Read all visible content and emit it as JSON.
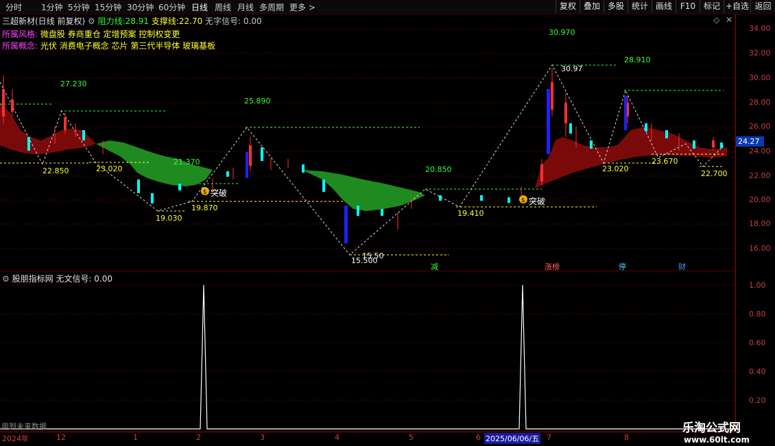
{
  "toolbar": {
    "timeframes": [
      "分时",
      "1分钟",
      "5分钟",
      "15分钟",
      "30分钟",
      "60分钟",
      "日线",
      "周线",
      "月线",
      "多周期",
      "更多 >"
    ],
    "active": "日线",
    "right_buttons": [
      "复权",
      "叠加",
      "多股",
      "统计",
      "画线",
      "F10",
      "标记",
      "+自选",
      "返回"
    ]
  },
  "main_panel": {
    "stock_name": "三超新材(日线 前复权)",
    "resistance_label": "阻力线:",
    "resistance_value": "28.91",
    "support_label": "支撑线:",
    "support_value": "22.70",
    "signal_text": "无字信号: 0.00",
    "style_label": "所属风格:",
    "style_value": "微盘股 券商重仓 定增预案 控制权变更",
    "concept_label": "所属概念:",
    "concept_value": "光伏 消费电子概念 芯片 第三代半导体 玻璃基板",
    "price_ticks": [
      "34.00",
      "32.00",
      "30.00",
      "28.00",
      "26.00",
      "24.00",
      "22.00",
      "20.00",
      "18.00",
      "16.00"
    ],
    "current_price": "24.27",
    "annotations": {
      "a1": "27.230",
      "a2": "22.850",
      "a3": "23.020",
      "a4": "19.030",
      "a5": "19.870",
      "a6": "21.370",
      "a7": "25.890",
      "a8": "15.500",
      "a9": "15.50",
      "a10": "20.850",
      "a11": "19.410",
      "a12": "30.970",
      "a13": "30.97",
      "a14": "28.910",
      "a15": "23.020",
      "a16": "23.670",
      "a17": "22.700",
      "breakout1": "突破",
      "breakout2": "突破"
    },
    "events": [
      "减",
      "涨榜",
      "停",
      "财"
    ]
  },
  "sub_panel": {
    "title": "股朋指标网",
    "signal_text": "无文信号: 0.00",
    "ticks": [
      "1.00",
      "0.80",
      "0.60",
      "0.40",
      "0.20"
    ],
    "footnote": "用到未来数据"
  },
  "date_axis": {
    "labels": [
      "2024年",
      "12",
      "1",
      "2",
      "3",
      "4",
      "5",
      "6",
      "2025/06/06/五",
      "7",
      "8"
    ]
  },
  "watermark": {
    "title": "乐淘公式网",
    "url": "www.60lt.com"
  },
  "colors": {
    "up": "#ff3030",
    "down": "#00ffff",
    "green_band": "#1f8a1f",
    "red_band": "#7a0a0a",
    "dashed_support": "#ffff33",
    "dashed_resist": "#33ff33"
  }
}
